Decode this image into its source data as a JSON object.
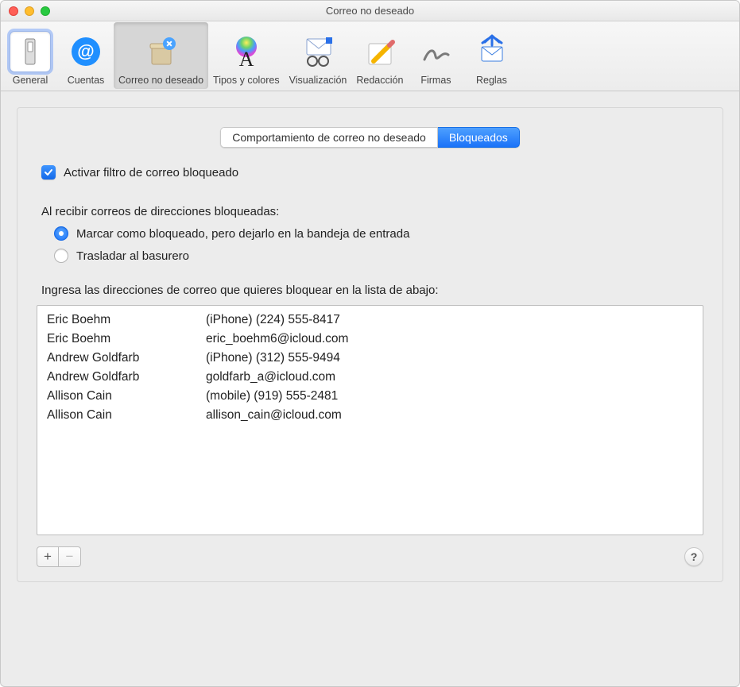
{
  "window_title": "Correo no deseado",
  "toolbar": [
    {
      "id": "general",
      "label": "General",
      "highlighted": true
    },
    {
      "id": "accounts",
      "label": "Cuentas"
    },
    {
      "id": "junk",
      "label": "Correo no deseado",
      "selected": true
    },
    {
      "id": "fonts",
      "label": "Tipos y colores"
    },
    {
      "id": "viewing",
      "label": "Visualización"
    },
    {
      "id": "composing",
      "label": "Redacción"
    },
    {
      "id": "signatures",
      "label": "Firmas"
    },
    {
      "id": "rules",
      "label": "Reglas"
    }
  ],
  "segments": {
    "behaviors": "Comportamiento de correo no deseado",
    "blocked": "Bloqueados",
    "active": "blocked"
  },
  "enable_checkbox": {
    "checked": true,
    "label": "Activar filtro de correo bloqueado"
  },
  "on_receive_label": "Al recibir correos de direcciones bloqueadas:",
  "radios": {
    "mark": "Marcar como bloqueado, pero dejarlo en la bandeja de entrada",
    "trash": "Trasladar al basurero",
    "selected": "mark"
  },
  "list_label": "Ingresa las direcciones de correo que quieres bloquear en la lista de abajo:",
  "blocked_list": [
    {
      "name": "Eric Boehm",
      "detail": "(iPhone) (224) 555-8417"
    },
    {
      "name": "Eric Boehm",
      "detail": "eric_boehm6@icloud.com"
    },
    {
      "name": "Andrew Goldfarb",
      "detail": "(iPhone) (312) 555-9494"
    },
    {
      "name": "Andrew Goldfarb",
      "detail": "goldfarb_a@icloud.com"
    },
    {
      "name": "Allison Cain",
      "detail": "(mobile) (919) 555-2481"
    },
    {
      "name": "Allison Cain",
      "detail": "allison_cain@icloud.com"
    }
  ],
  "buttons": {
    "add": "+",
    "remove": "−",
    "help": "?"
  }
}
